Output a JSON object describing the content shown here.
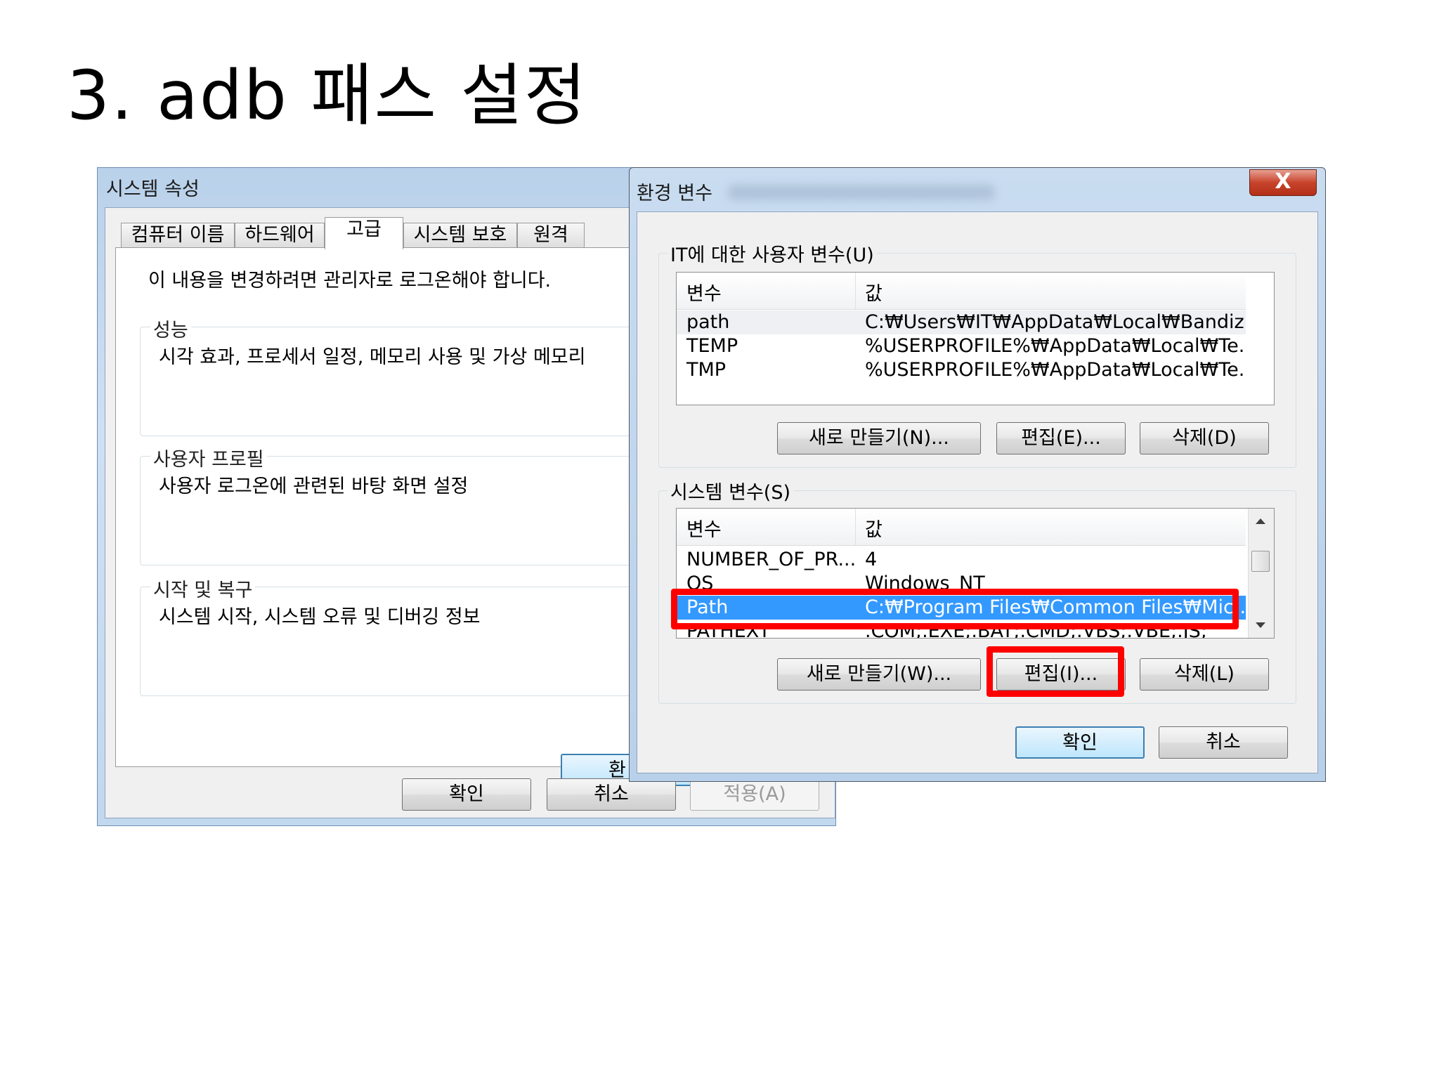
{
  "slide": {
    "title": "3. adb 패스 설정"
  },
  "system_properties": {
    "title": "시스템 속성",
    "tabs": [
      "컴퓨터 이름",
      "하드웨어",
      "고급",
      "시스템 보호",
      "원격"
    ],
    "active_tab": "고급",
    "admin_message": "이 내용을 변경하려면 관리자로 로그온해야 합니다.",
    "groups": [
      {
        "legend": "성능",
        "description": "시각 효과, 프로세서 일정, 메모리 사용 및 가상 메모리"
      },
      {
        "legend": "사용자 프로필",
        "description": "사용자 로그온에 관련된 바탕 화면 설정"
      },
      {
        "legend": "시작 및 복구",
        "description": "시스템 시작, 시스템 오류 및 디버깅 정보"
      }
    ],
    "env_button_partial": "환",
    "buttons": {
      "ok": "확인",
      "cancel": "취소",
      "apply": "적용(A)"
    }
  },
  "environment_variables": {
    "title": "환경 변수",
    "close_label": "X",
    "user_section": {
      "legend": "IT에 대한 사용자 변수(U)",
      "columns": [
        "변수",
        "값"
      ],
      "rows": [
        {
          "name": "path",
          "value": "C:₩Users₩IT₩AppData₩Local₩Bandiz..."
        },
        {
          "name": "TEMP",
          "value": "%USERPROFILE%₩AppData₩Local₩Te..."
        },
        {
          "name": "TMP",
          "value": "%USERPROFILE%₩AppData₩Local₩Te..."
        }
      ],
      "buttons": {
        "new": "새로 만들기(N)...",
        "edit": "편집(E)...",
        "delete": "삭제(D)"
      }
    },
    "system_section": {
      "legend": "시스템 변수(S)",
      "columns": [
        "변수",
        "값"
      ],
      "rows": [
        {
          "name": "NUMBER_OF_PR...",
          "value": "4"
        },
        {
          "name": "OS",
          "value": "Windows_NT"
        },
        {
          "name": "Path",
          "value": "C:₩Program Files₩Common Files₩Mic..."
        },
        {
          "name": "PATHEXT",
          "value": ".COM;.EXE;.BAT;.CMD;.VBS;.VBE;.JS;"
        }
      ],
      "selected_row": "Path",
      "buttons": {
        "new": "새로 만들기(W)...",
        "edit": "편집(I)...",
        "delete": "삭제(L)"
      }
    },
    "buttons": {
      "ok": "확인",
      "cancel": "취소"
    },
    "highlight_color": "#ff0000",
    "selection_color": "#3399ff"
  }
}
